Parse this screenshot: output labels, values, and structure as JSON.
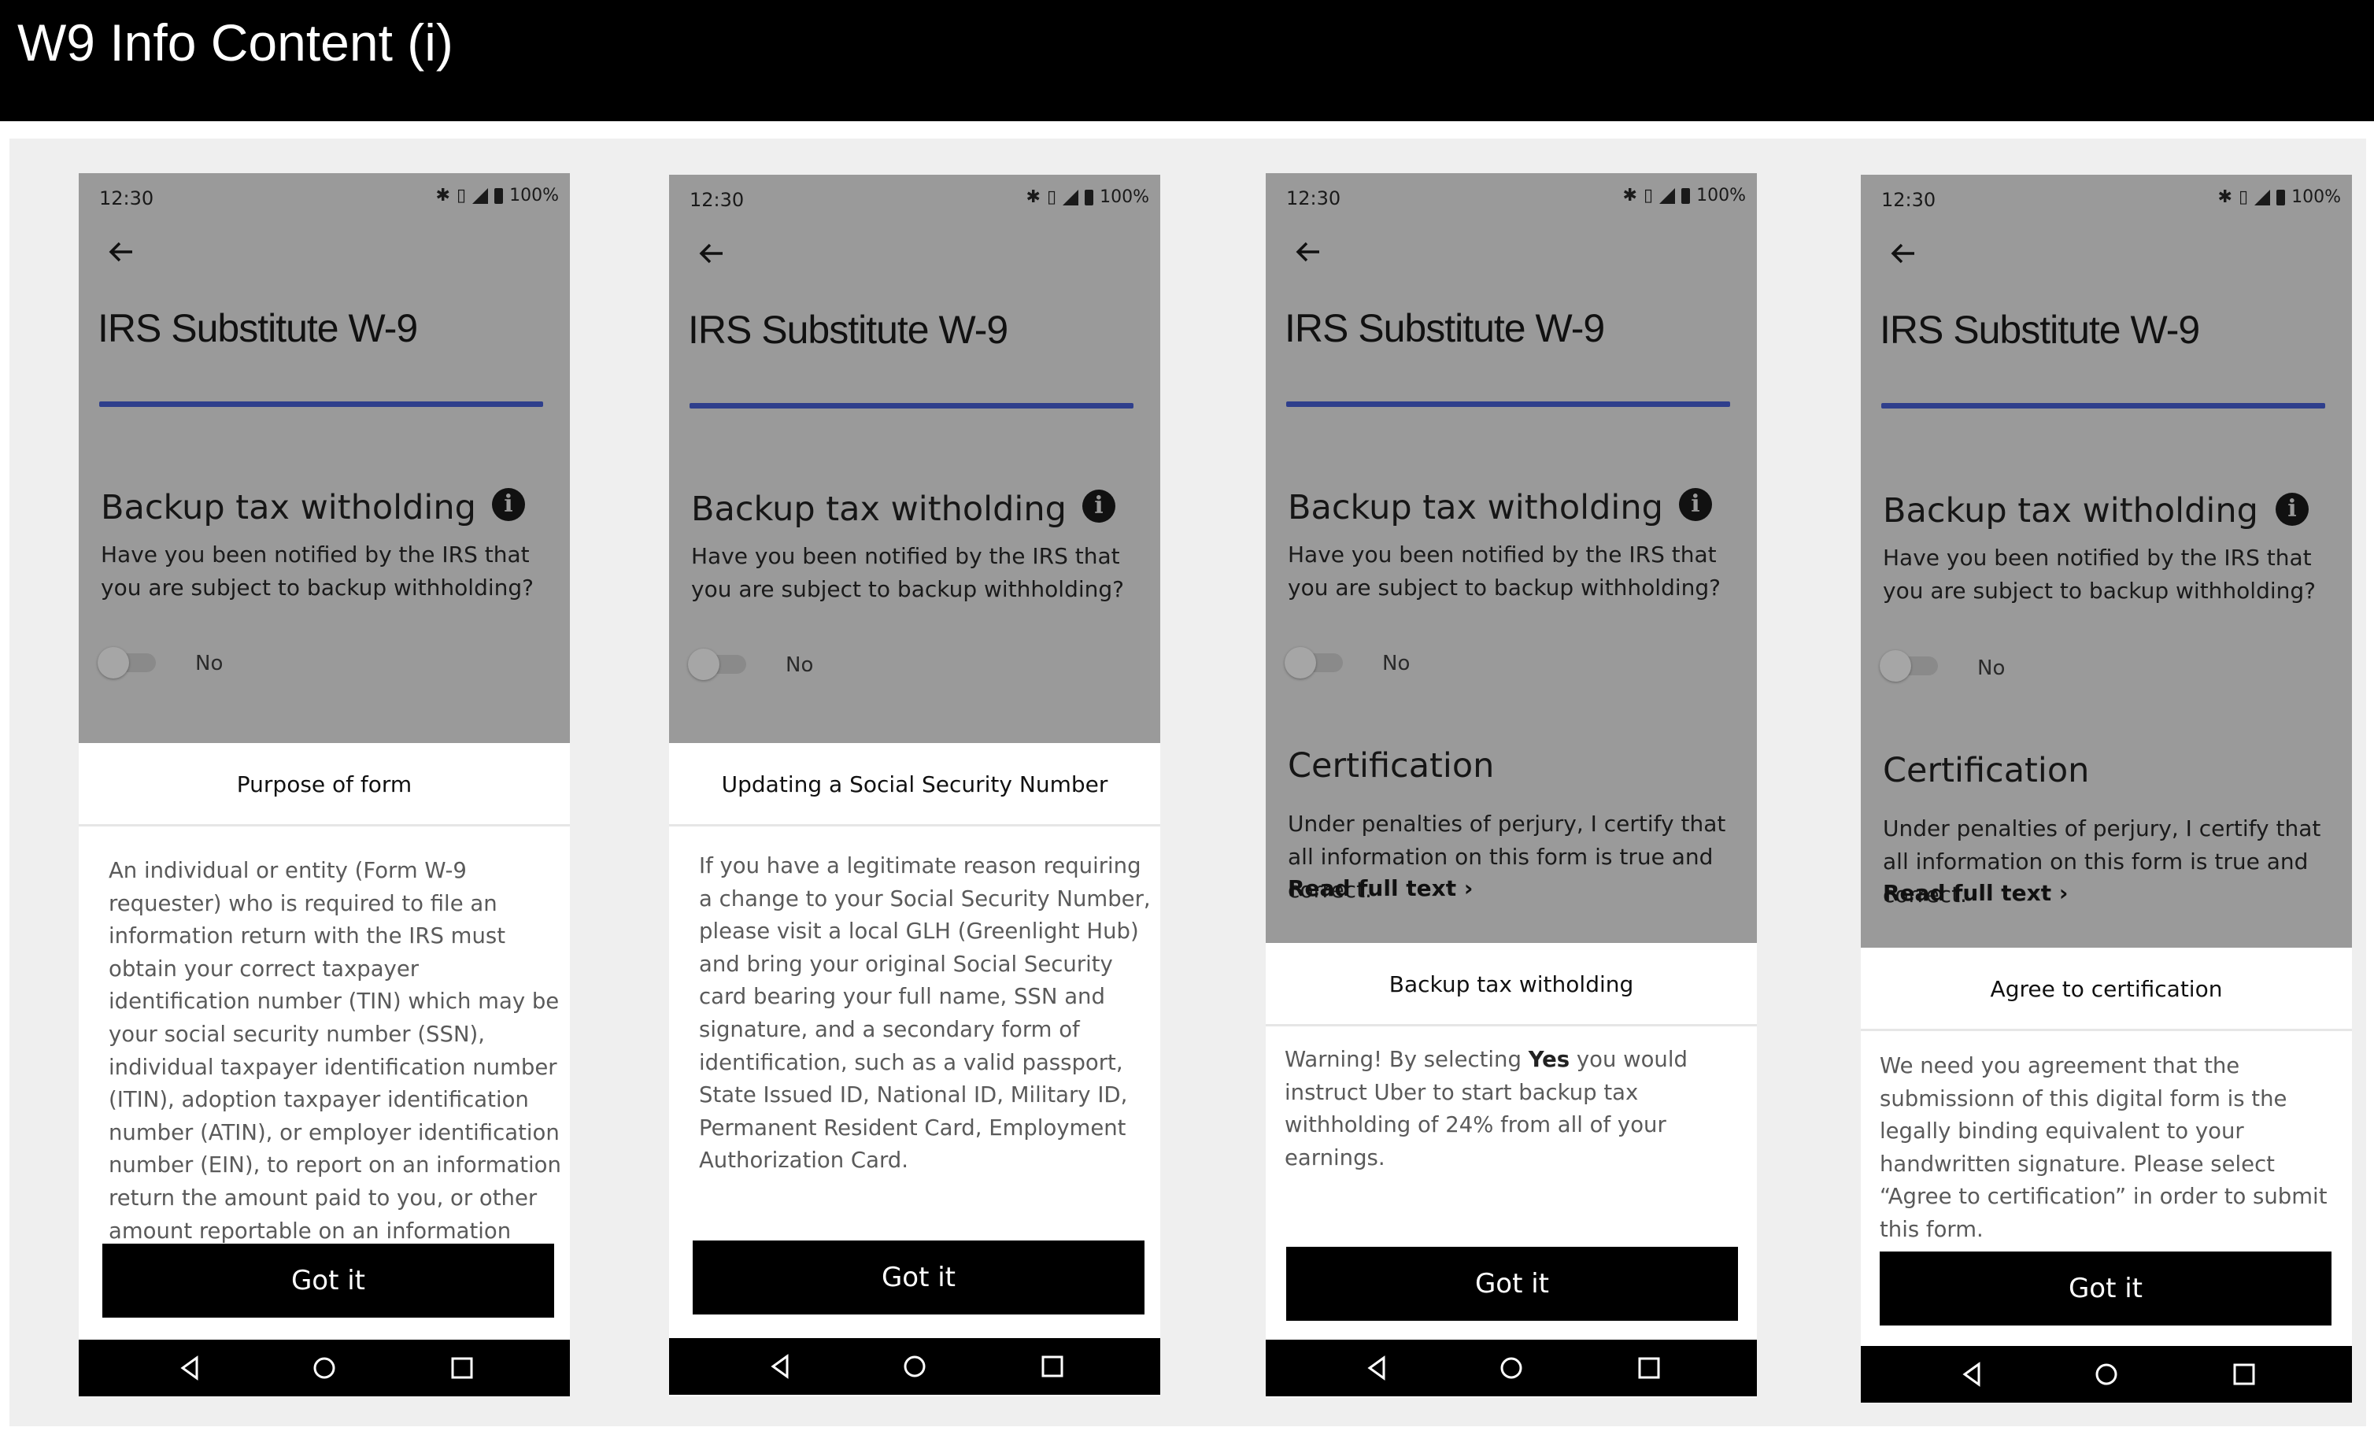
{
  "page": {
    "title": "W9 Info Content (i)"
  },
  "phones": [
    {
      "status": {
        "time": "12:30",
        "battery": "100%"
      },
      "title": "IRS Substitute W-9",
      "section_title": "Backup tax witholding",
      "question": "Have you been notified by the IRS that you are subject to backup withholding?",
      "toggle_label": "No",
      "sheet_title": "Purpose of form",
      "sheet_body": "An individual or entity (Form W-9 requester) who is required to file an information return with the IRS must obtain your correct taxpayer identification number (TIN) which may be your social security number (SSN), individual taxpayer identification number (ITIN), adoption taxpayer identification number (ATIN), or employer identification number (EIN), to report on an information return the amount paid to you, or other amount reportable on an information return.",
      "button": "Got it"
    },
    {
      "status": {
        "time": "12:30",
        "battery": "100%"
      },
      "title": "IRS Substitute W-9",
      "section_title": "Backup tax witholding",
      "question": "Have you been notified by the IRS that you are subject to backup withholding?",
      "toggle_label": "No",
      "sheet_title": "Updating a Social Security Number",
      "sheet_body": "If you have a legitimate reason requiring a change to your Social Security Number, please visit a local GLH (Greenlight Hub) and bring your original Social Security card bearing your full name, SSN and signature, and a secondary form of identification, such as a valid passport, State Issued ID, National ID, Military ID, Permanent Resident Card, Employment Authorization Card.",
      "button": "Got it"
    },
    {
      "status": {
        "time": "12:30",
        "battery": "100%"
      },
      "title": "IRS Substitute W-9",
      "section_title": "Backup tax witholding",
      "question": "Have you been notified by the IRS that you are subject to backup withholding?",
      "toggle_label": "No",
      "cert_title": "Certification",
      "cert_text": "Under penalties of perjury, I certify that all information on this form is true and correct.",
      "read_more": "Read full text ›",
      "sheet_title": "Backup tax witholding",
      "sheet_body_pre": "Warning! By selecting ",
      "sheet_body_bold": "Yes",
      "sheet_body_post": " you would instruct Uber to start backup tax withholding of 24% from all of your earnings.",
      "button": "Got it"
    },
    {
      "status": {
        "time": "12:30",
        "battery": "100%"
      },
      "title": "IRS Substitute W-9",
      "section_title": "Backup tax witholding",
      "question": "Have you been notified by the IRS that you are subject to backup withholding?",
      "toggle_label": "No",
      "cert_title": "Certification",
      "cert_text": "Under penalties of perjury, I certify that all information on this form is true and correct.",
      "read_more": "Read full text ›",
      "sheet_title": "Agree to certification",
      "sheet_body": "We need you agreement that the submissionn of this digital form is the legally binding equivalent to your handwritten signature. Please select “Agree to certification” in order to submit this form.",
      "button": "Got it"
    }
  ]
}
